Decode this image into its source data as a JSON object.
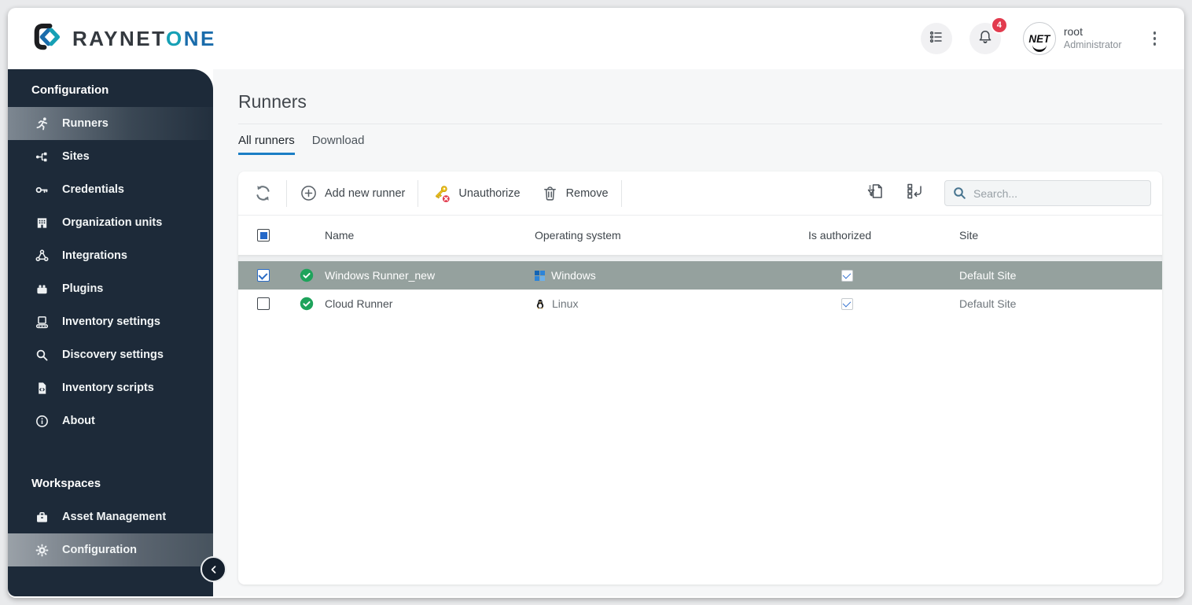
{
  "header": {
    "logo": {
      "text_primary": "RAYNET",
      "text_accent_o": "O",
      "text_accent_ne": "NE"
    },
    "notifications_count": "4",
    "user": {
      "name": "root",
      "role": "Administrator",
      "avatar_text": "NET"
    }
  },
  "sidebar": {
    "section1_title": "Configuration",
    "config_items": [
      {
        "label": "Runners",
        "selected": true
      },
      {
        "label": "Sites"
      },
      {
        "label": "Credentials"
      },
      {
        "label": "Organization units"
      },
      {
        "label": "Integrations"
      },
      {
        "label": "Plugins"
      },
      {
        "label": "Inventory settings"
      },
      {
        "label": "Discovery settings"
      },
      {
        "label": "Inventory scripts"
      },
      {
        "label": "About"
      }
    ],
    "section2_title": "Workspaces",
    "workspace_items": [
      {
        "label": "Asset Management"
      },
      {
        "label": "Configuration",
        "selected": true
      }
    ]
  },
  "main": {
    "title": "Runners",
    "tabs": [
      {
        "label": "All runners",
        "active": true
      },
      {
        "label": "Download",
        "active": false
      }
    ],
    "toolbar": {
      "add_label": "Add new runner",
      "unauthorize_label": "Unauthorize",
      "remove_label": "Remove",
      "search_placeholder": "Search..."
    },
    "table": {
      "columns": [
        "Name",
        "Operating system",
        "Is authorized",
        "Site"
      ],
      "rows": [
        {
          "name": "Windows Runner_new",
          "os": "Windows",
          "authorized": true,
          "site": "Default Site",
          "selected": true,
          "status": "online"
        },
        {
          "name": "Cloud Runner",
          "os": "Linux",
          "authorized": true,
          "site": "Default Site",
          "selected": false,
          "status": "online"
        }
      ]
    }
  },
  "colors": {
    "sidebar_bg": "#1d2a39",
    "selected_row_bg": "#95a19e",
    "tab_underline": "#1b7ec5",
    "badge_red": "#e23b4e",
    "status_green": "#1ea35b",
    "accent_teal": "#16a0b5",
    "accent_blue": "#1a6cab"
  }
}
